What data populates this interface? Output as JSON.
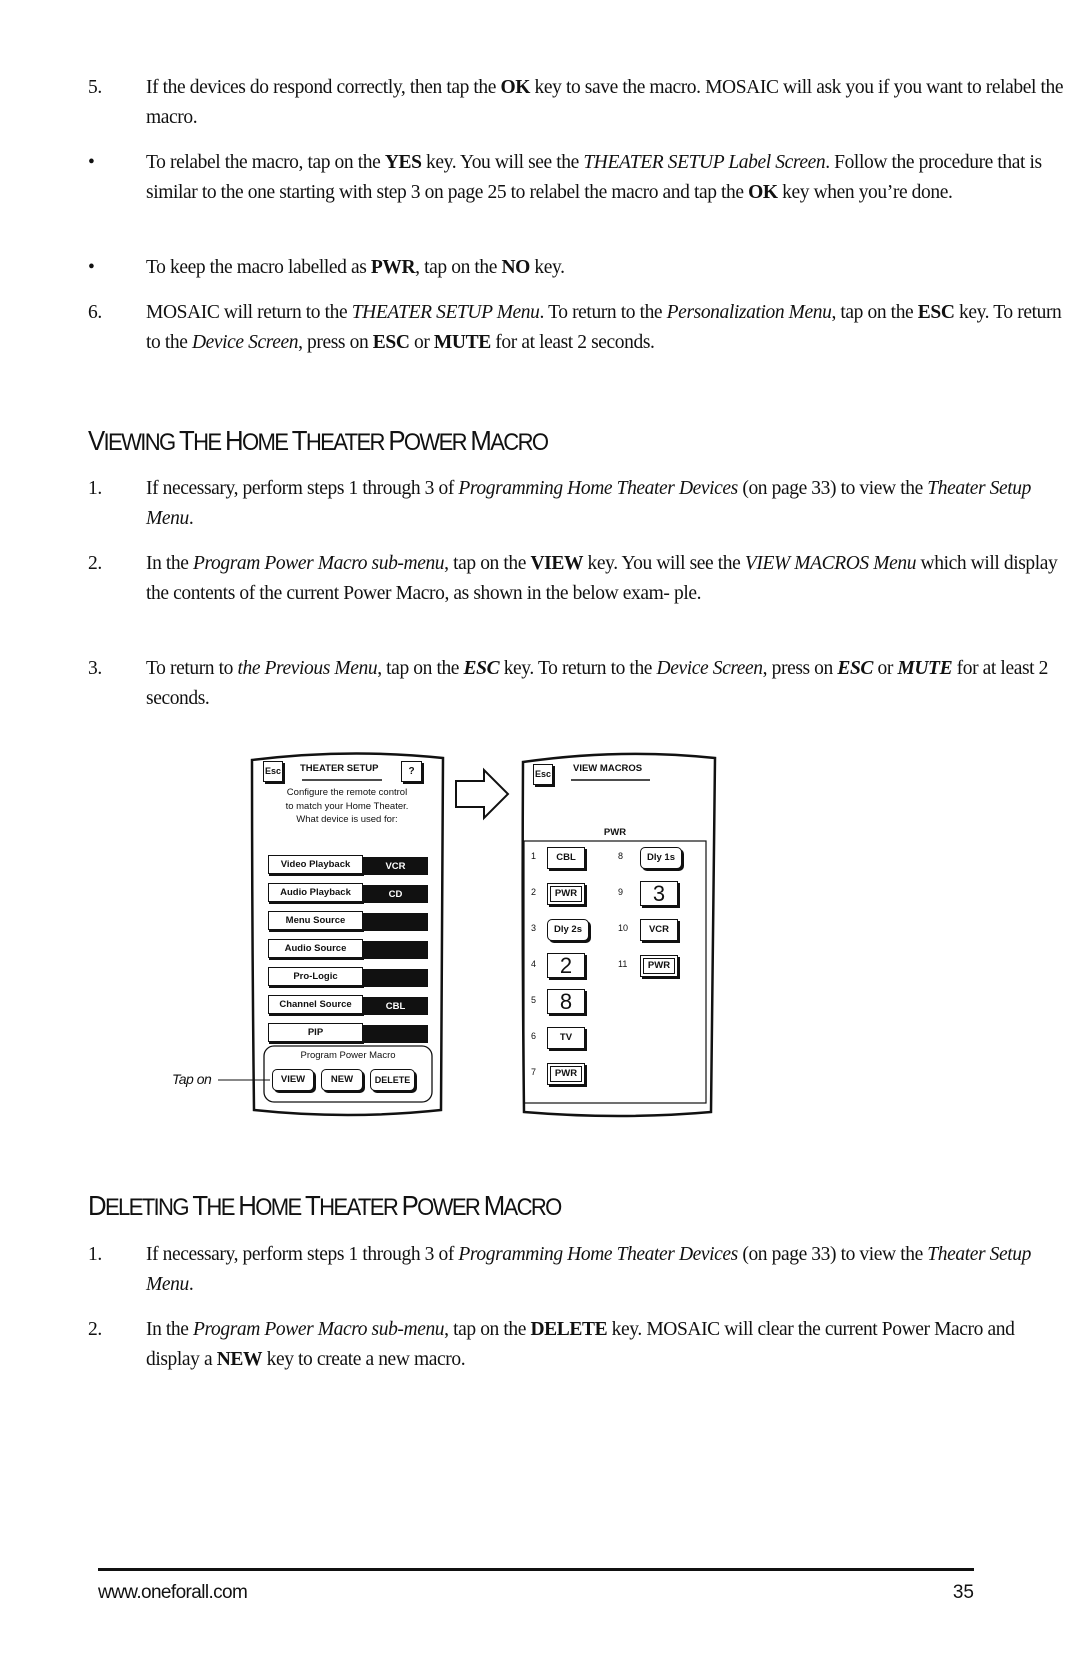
{
  "intro_steps": [
    {
      "marker": "5.",
      "html_segments": [
        {
          "t": "If the devices do respond correctly, then tap the "
        },
        {
          "t": "OK",
          "b": true
        },
        {
          "t": " key to save the macro. MOSAIC will ask you if you want to relabel the macro."
        }
      ]
    },
    {
      "marker": "•",
      "html_segments": [
        {
          "t": "To relabel the macro, tap on the "
        },
        {
          "t": "YES",
          "b": true
        },
        {
          "t": " key. You will see the "
        },
        {
          "t": "THEATER SETUP Label Screen",
          "i": true
        },
        {
          "t": ". Follow the procedure that is similar to the one starting with step 3 on page 25 to relabel the macro and tap the "
        },
        {
          "t": "OK",
          "b": true
        },
        {
          "t": " key when you’re done."
        }
      ]
    },
    {
      "marker": "•",
      "html_segments": [
        {
          "t": "To keep the macro labelled as "
        },
        {
          "t": "PWR",
          "b": true
        },
        {
          "t": ", tap on the "
        },
        {
          "t": "NO",
          "b": true
        },
        {
          "t": " key."
        }
      ]
    },
    {
      "marker": "6.",
      "html_segments": [
        {
          "t": "MOSAIC will return to the "
        },
        {
          "t": "THEATER SETUP Menu",
          "i": true
        },
        {
          "t": ". To return to the "
        },
        {
          "t": "Personalization Menu",
          "i": true
        },
        {
          "t": ", tap on the "
        },
        {
          "t": "ESC",
          "b": true
        },
        {
          "t": " key. To return to the "
        },
        {
          "t": "Device Screen",
          "i": true
        },
        {
          "t": ", press on "
        },
        {
          "t": "ESC",
          "b": true
        },
        {
          "t": " or "
        },
        {
          "t": "MUTE",
          "b": true
        },
        {
          "t": " for at least 2 seconds."
        }
      ]
    }
  ],
  "section_viewing": {
    "heading": "Viewing The Home Theater Power Macro",
    "steps": [
      {
        "marker": "1.",
        "html_segments": [
          {
            "t": "If necessary, perform steps 1 through 3 of "
          },
          {
            "t": "Programming Home Theater Devices",
            "i": true
          },
          {
            "t": " (on page 33) to view the "
          },
          {
            "t": "Theater Setup Menu",
            "i": true
          },
          {
            "t": "."
          }
        ]
      },
      {
        "marker": "2.",
        "html_segments": [
          {
            "t": "In the "
          },
          {
            "t": "Program Power Macro sub-menu",
            "i": true
          },
          {
            "t": ", tap on the "
          },
          {
            "t": "VIEW",
            "b": true
          },
          {
            "t": " key. You will see the "
          },
          {
            "t": "VIEW MACROS Menu",
            "i": true
          },
          {
            "t": " which will display the contents of the current Power Macro, as shown in the below exam- ple."
          }
        ]
      },
      {
        "marker": "3.",
        "html_segments": [
          {
            "t": "To return to "
          },
          {
            "t": "the Previous Menu",
            "i": true
          },
          {
            "t": ", tap on the "
          },
          {
            "t": "ESC",
            "b": true,
            "i": true
          },
          {
            "t": " key. To return to the "
          },
          {
            "t": "Device Screen",
            "i": true
          },
          {
            "t": ", press on "
          },
          {
            "t": "ESC",
            "b": true,
            "i": true
          },
          {
            "t": " or "
          },
          {
            "t": "MUTE",
            "b": true,
            "i": true
          },
          {
            "t": " for at least 2 seconds."
          }
        ]
      }
    ]
  },
  "diagram": {
    "theater_setup": {
      "esc_label": "Esc",
      "title": "THEATER SETUP",
      "help_label": "?",
      "description_lines": [
        "Configure the remote control",
        "to match your Home Theater.",
        "What device is used for:"
      ],
      "settings": [
        {
          "label": "Video Playback",
          "value": "VCR"
        },
        {
          "label": "Audio Playback",
          "value": "CD"
        },
        {
          "label": "Menu Source",
          "value": ""
        },
        {
          "label": "Audio Source",
          "value": ""
        },
        {
          "label": "Pro-Logic",
          "value": ""
        },
        {
          "label": "Channel Source",
          "value": "CBL"
        },
        {
          "label": "PIP",
          "value": ""
        }
      ],
      "macro_group_title": "Program Power Macro",
      "macro_buttons": [
        "VIEW",
        "NEW",
        "DELETE"
      ],
      "callout": "Tap on"
    },
    "view_macros": {
      "esc_label": "Esc",
      "title": "VIEW MACROS",
      "macro_name": "PWR",
      "steps": [
        {
          "n": "1",
          "label": "CBL",
          "style": "square"
        },
        {
          "n": "2",
          "label": "PWR",
          "style": "double"
        },
        {
          "n": "3",
          "label": "Dly 2s",
          "style": "round"
        },
        {
          "n": "4",
          "label": "2",
          "style": "big"
        },
        {
          "n": "5",
          "label": "8",
          "style": "big"
        },
        {
          "n": "6",
          "label": "TV",
          "style": "square"
        },
        {
          "n": "7",
          "label": "PWR",
          "style": "double"
        },
        {
          "n": "8",
          "label": "Dly 1s",
          "style": "round"
        },
        {
          "n": "9",
          "label": "3",
          "style": "big"
        },
        {
          "n": "10",
          "label": "VCR",
          "style": "square"
        },
        {
          "n": "11",
          "label": "PWR",
          "style": "double"
        }
      ]
    }
  },
  "section_deleting": {
    "heading": "Deleting The Home Theater Power Macro",
    "steps": [
      {
        "marker": "1.",
        "html_segments": [
          {
            "t": "If necessary, perform steps 1 through 3 of "
          },
          {
            "t": "Programming Home Theater Devices",
            "i": true
          },
          {
            "t": " (on page 33) to view the "
          },
          {
            "t": "Theater Setup Menu",
            "i": true
          },
          {
            "t": "."
          }
        ]
      },
      {
        "marker": "2.",
        "html_segments": [
          {
            "t": "In the "
          },
          {
            "t": "Program Power Macro sub-menu",
            "i": true
          },
          {
            "t": ", tap on the "
          },
          {
            "t": "DELETE",
            "b": true
          },
          {
            "t": " key. MOSAIC will clear the current Power Macro and display a "
          },
          {
            "t": "NEW",
            "b": true
          },
          {
            "t": " key to create a new macro."
          }
        ]
      }
    ]
  },
  "footer": {
    "url": "www.oneforall.com",
    "page_number": "35"
  }
}
